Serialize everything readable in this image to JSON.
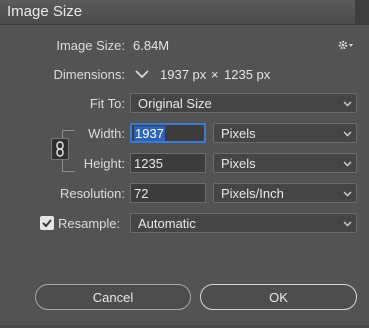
{
  "window": {
    "title": "Image Size"
  },
  "image_size": {
    "label": "Image Size:",
    "value": "6.84M"
  },
  "dimensions": {
    "label": "Dimensions:",
    "width_value": "1937 px",
    "times": "×",
    "height_value": "1235 px"
  },
  "fit_to": {
    "label": "Fit To:",
    "value": "Original Size"
  },
  "width": {
    "label": "Width:",
    "value": "1937",
    "unit": "Pixels"
  },
  "height": {
    "label": "Height:",
    "value": "1235",
    "unit": "Pixels"
  },
  "resolution": {
    "label": "Resolution:",
    "value": "72",
    "unit": "Pixels/Inch"
  },
  "resample": {
    "label": "Resample:",
    "checked": true,
    "value": "Automatic"
  },
  "buttons": {
    "cancel": "Cancel",
    "ok": "OK"
  },
  "icons": {
    "settings": "gear-icon",
    "dimensions_menu": "chevron-down-icon",
    "constrain": "chain-link-icon",
    "checkbox": "checkmark-icon"
  },
  "colors": {
    "background": "#535353",
    "focus": "#3a7bd5",
    "selection": "#2d62b8"
  }
}
